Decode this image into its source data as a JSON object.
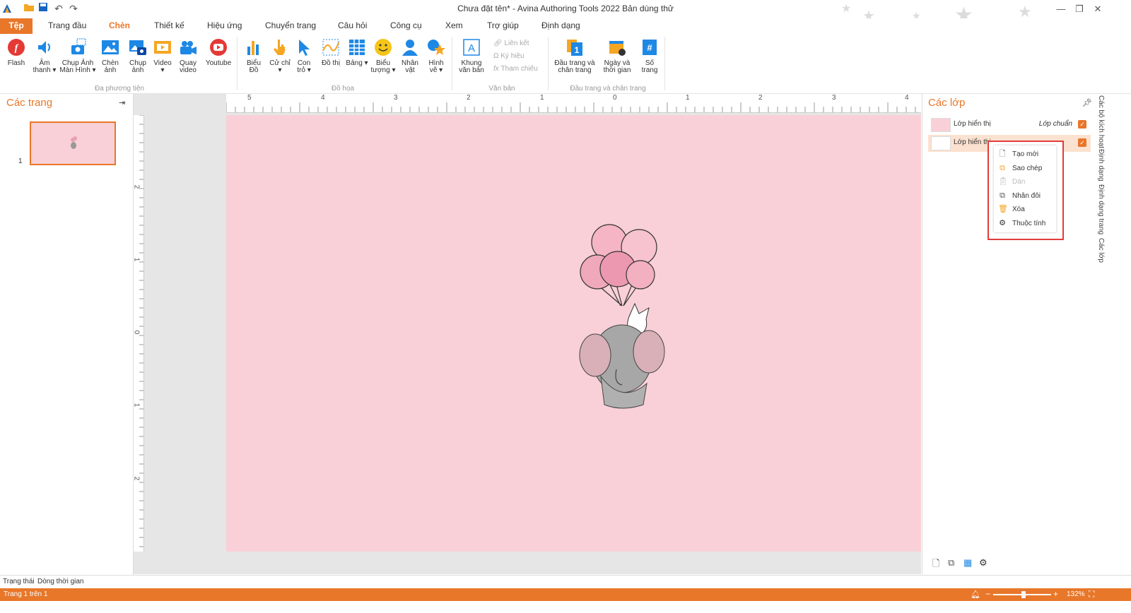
{
  "window": {
    "title": "Chưa đặt tên* - Avina Authoring Tools 2022 Bản dùng thử"
  },
  "menu": {
    "file": "Tệp",
    "tabs": [
      "Trang đầu",
      "Chèn",
      "Thiết kế",
      "Hiệu ứng",
      "Chuyển trang",
      "Câu hỏi",
      "Công cụ",
      "Xem",
      "Trợ giúp",
      "Định dạng"
    ],
    "active_tab": "Chèn"
  },
  "ribbon": {
    "media": {
      "group_label": "Đa phương tiện",
      "flash": "Flash",
      "audio": "Âm thanh ▾",
      "screenshot": "Chụp Ảnh Màn Hình ▾",
      "insert_image": "Chèn ảnh",
      "capture_image": "Chụp ảnh",
      "video": "Video ▾",
      "record_video": "Quay video",
      "youtube": "Youtube"
    },
    "graphics": {
      "group_label": "Đồ họa",
      "chart": "Biểu Đồ",
      "gesture": "Cử chỉ ▾",
      "pointer": "Con trỏ ▾",
      "graph": "Đồ thị",
      "table": "Bảng ▾",
      "emoji": "Biểu tượng ▾",
      "character": "Nhân vật",
      "shape": "Hình vẽ ▾"
    },
    "text": {
      "group_label": "Văn bản",
      "textbox": "Khung văn bản",
      "link": "Liên kết",
      "symbol": "Ký hiệu",
      "reference": "Tham chiếu"
    },
    "header_footer": {
      "group_label": "Đầu trang và chân trang",
      "header_footer": "Đầu trang và chân trang",
      "datetime": "Ngày và thời gian",
      "page_number": "Số trang"
    }
  },
  "pages_panel": {
    "title": "Các trang",
    "page_number": "1"
  },
  "ruler": {
    "h_ticks": [
      "5",
      "4",
      "3",
      "2",
      "1",
      "0",
      "1",
      "2",
      "3",
      "4"
    ],
    "v_ticks": [
      "2",
      "1",
      "0",
      "1",
      "2"
    ]
  },
  "layers_panel": {
    "title": "Các lớp",
    "layers": [
      {
        "name": "Lớp hiển thị",
        "tag": "Lớp chuẩn",
        "checked": true
      },
      {
        "name": "Lớp hiển thị",
        "tag": "",
        "checked": true
      }
    ],
    "context_menu": [
      {
        "label": "Tạo mới",
        "icon": "new-page-icon",
        "enabled": true
      },
      {
        "label": "Sao chép",
        "icon": "copy-icon",
        "enabled": true
      },
      {
        "label": "Dán",
        "icon": "paste-icon",
        "enabled": false
      },
      {
        "label": "Nhân đôi",
        "icon": "duplicate-icon",
        "enabled": true
      },
      {
        "label": "Xóa",
        "icon": "trash-icon",
        "enabled": true
      },
      {
        "label": "Thuộc tính",
        "icon": "gear-icon",
        "enabled": true
      }
    ]
  },
  "right_tabs": [
    "Các bộ kích hoạt",
    "Định dạng",
    "Định dạng trang",
    "Các lớp"
  ],
  "bottom_tabs": [
    "Trạng thái",
    "Dòng thời gian"
  ],
  "status": {
    "page_info": "Trang 1 trên 1",
    "zoom": "132%",
    "zoom_minus": "−",
    "zoom_plus": "+",
    "zoom_level": 0.53
  },
  "colors": {
    "accent": "#e8772a",
    "slide_bg": "#f9d0d7",
    "highlight_border": "#e23b3b"
  }
}
